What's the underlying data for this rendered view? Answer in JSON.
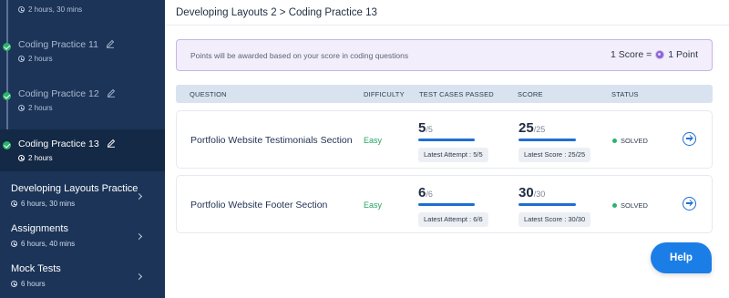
{
  "sidebar": {
    "top_meta": "2 hours, 30 mins",
    "practices": [
      {
        "title": "Coding Practice 11",
        "duration": "2 hours"
      },
      {
        "title": "Coding Practice 12",
        "duration": "2 hours"
      },
      {
        "title": "Coding Practice 13",
        "duration": "2 hours"
      }
    ],
    "sections": [
      {
        "title": "Developing Layouts Practice",
        "duration": "6 hours, 30 mins"
      },
      {
        "title": "Assignments",
        "duration": "6 hours, 40 mins"
      },
      {
        "title": "Mock Tests",
        "duration": "6 hours"
      }
    ]
  },
  "header": {
    "breadcrumb": "Developing Layouts 2 > Coding Practice 13"
  },
  "banner": {
    "text": "Points will be awarded based on your score in coding questions",
    "score_label": "1 Score =",
    "point_label": "1 Point",
    "coin_icon": "points-coin-icon"
  },
  "table": {
    "headers": {
      "question": "QUESTION",
      "difficulty": "DIFFICULTY",
      "tests": "TEST CASES PASSED",
      "score": "SCORE",
      "status": "STATUS"
    },
    "rows": [
      {
        "question": "Portfolio Website Testimonials Section",
        "difficulty": "Easy",
        "tests_passed": "5",
        "tests_total": "/5",
        "attempt": "Latest Attempt : 5/5",
        "score": "25",
        "score_total": "/25",
        "score_label": "Latest Score : 25/25",
        "status": "SOLVED",
        "tests_fraction": 1.0,
        "score_fraction": 1.0
      },
      {
        "question": "Portfolio Website Footer Section",
        "difficulty": "Easy",
        "tests_passed": "6",
        "tests_total": "/6",
        "attempt": "Latest Attempt : 6/6",
        "score": "30",
        "score_total": "/30",
        "score_label": "Latest Score : 30/30",
        "status": "SOLVED",
        "tests_fraction": 1.0,
        "score_fraction": 1.0
      }
    ]
  },
  "help": {
    "label": "Help"
  },
  "colors": {
    "sidebar_bg": "#1b3458",
    "accent_blue": "#1f6fd1",
    "success_green": "#2bb36a",
    "banner_border": "#c7b4e6"
  }
}
